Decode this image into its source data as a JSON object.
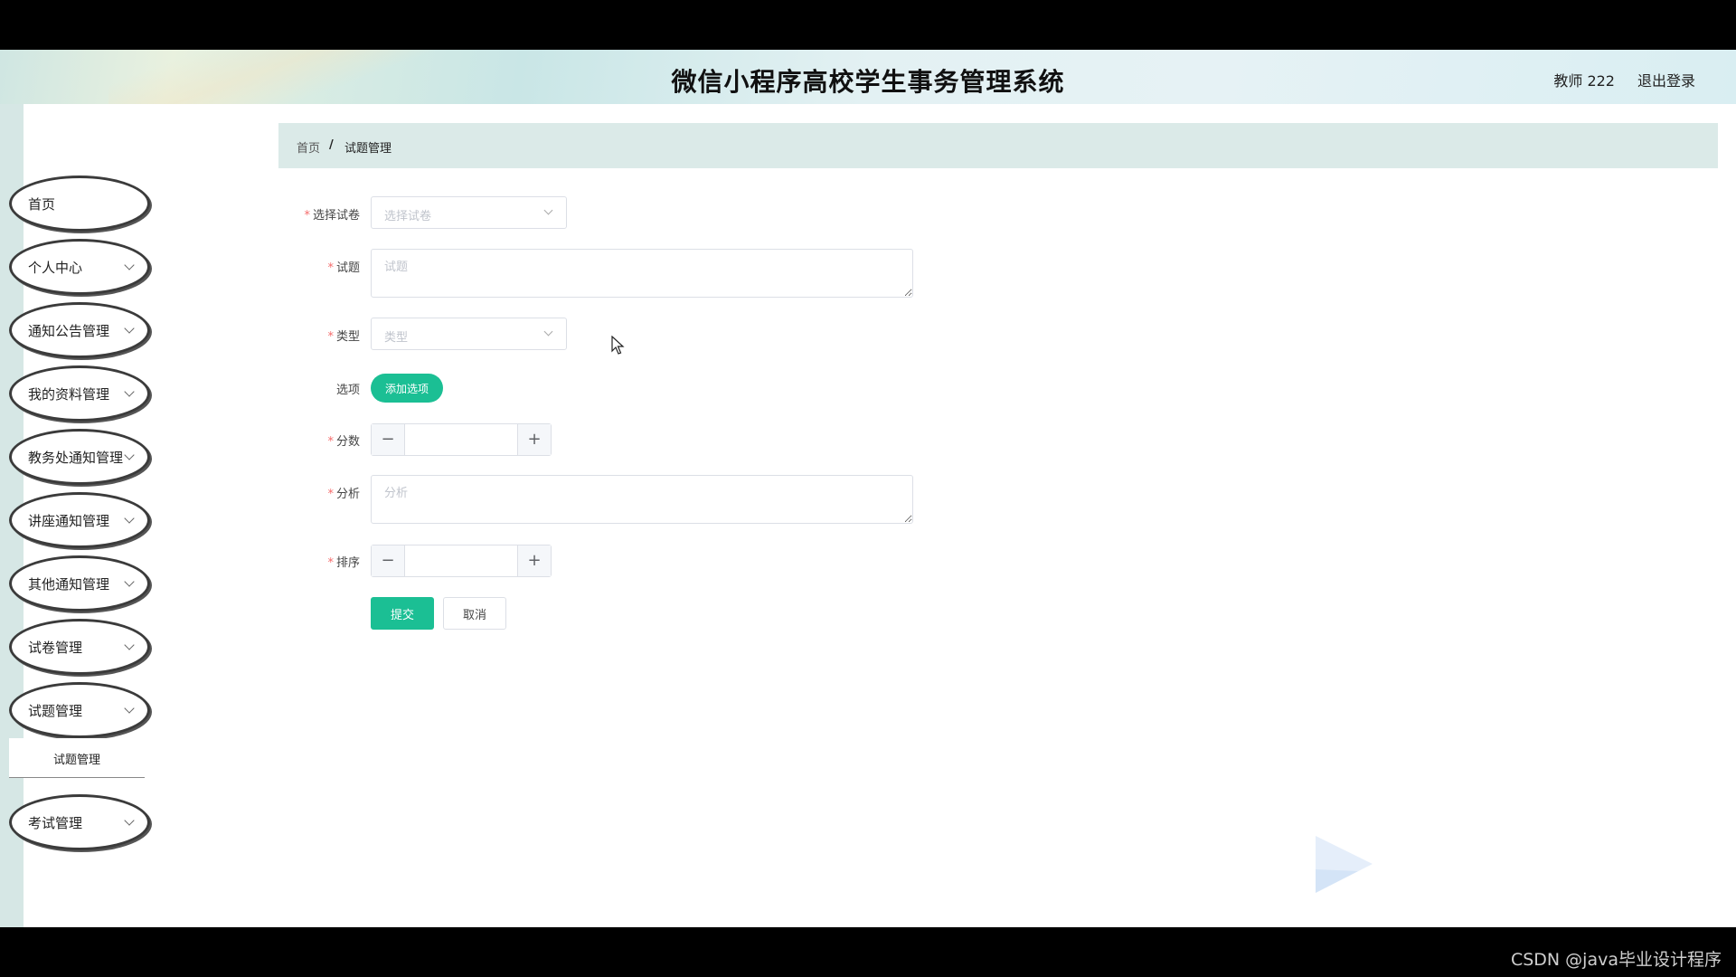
{
  "header": {
    "title": "微信小程序高校学生事务管理系统",
    "user": "教师 222",
    "logout": "退出登录"
  },
  "sidebar": {
    "items": [
      {
        "label": "首页",
        "expandable": false
      },
      {
        "label": "个人中心",
        "expandable": true
      },
      {
        "label": "通知公告管理",
        "expandable": true
      },
      {
        "label": "我的资料管理",
        "expandable": true
      },
      {
        "label": "教务处通知管理",
        "expandable": true
      },
      {
        "label": "讲座通知管理",
        "expandable": true
      },
      {
        "label": "其他通知管理",
        "expandable": true
      },
      {
        "label": "试卷管理",
        "expandable": true
      },
      {
        "label": "试题管理",
        "expandable": true
      },
      {
        "label": "考试管理",
        "expandable": true
      }
    ],
    "submenu": {
      "label": "试题管理"
    }
  },
  "breadcrumb": {
    "home": "首页",
    "separator": "/",
    "current": "试题管理"
  },
  "form": {
    "paper": {
      "label": "选择试卷",
      "placeholder": "选择试卷",
      "required": true
    },
    "question": {
      "label": "试题",
      "placeholder": "试题",
      "required": true
    },
    "type": {
      "label": "类型",
      "placeholder": "类型",
      "required": true
    },
    "options": {
      "label": "选项",
      "add_button": "添加选项"
    },
    "score": {
      "label": "分数",
      "required": true,
      "value": ""
    },
    "analysis": {
      "label": "分析",
      "placeholder": "分析",
      "required": true
    },
    "order": {
      "label": "排序",
      "required": true,
      "value": ""
    },
    "required_mark": "*",
    "submit": "提交",
    "cancel": "取消"
  },
  "watermark": "CSDN @java毕业设计程序",
  "colors": {
    "accent": "#1bbf94",
    "required": "#f56c6c",
    "breadcrumb_bg": "#dbeae8"
  }
}
